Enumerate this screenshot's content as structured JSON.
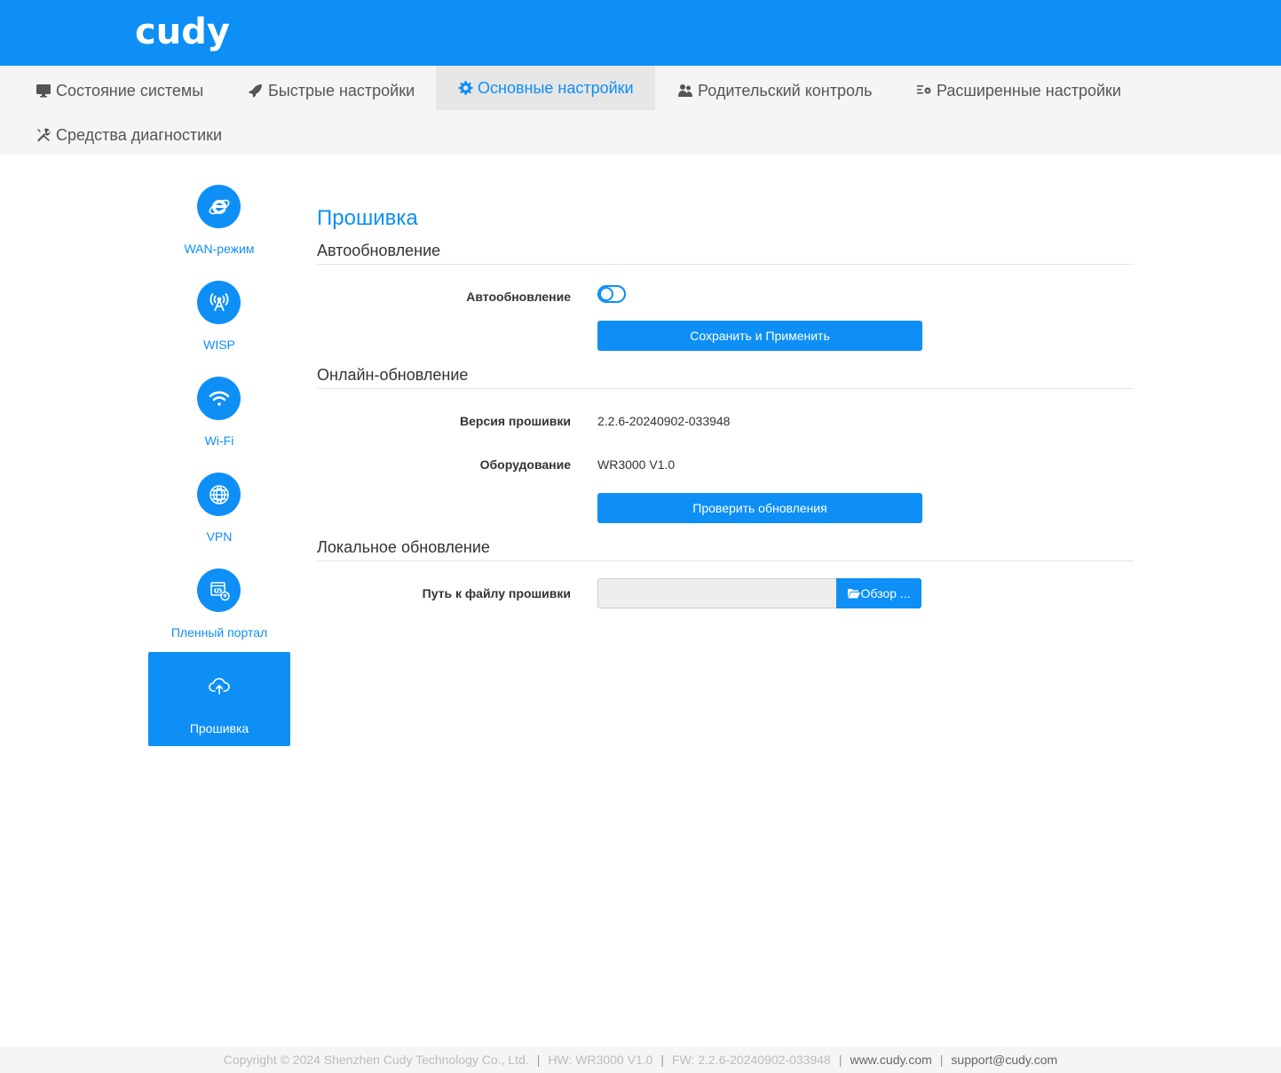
{
  "header": {
    "logo": "cudy"
  },
  "nav": {
    "items": [
      {
        "label": "Состояние системы",
        "icon": "monitor-icon"
      },
      {
        "label": "Быстрые настройки",
        "icon": "rocket-icon"
      },
      {
        "label": "Основные настройки",
        "icon": "gear-icon",
        "active": true
      },
      {
        "label": "Родительский контроль",
        "icon": "users-icon"
      },
      {
        "label": "Расширенные настройки",
        "icon": "advanced-settings-icon"
      },
      {
        "label": "Средства диагностики",
        "icon": "tools-icon"
      }
    ]
  },
  "sidebar": {
    "items": [
      {
        "label": "WAN-режим",
        "icon": "internet-explorer-icon"
      },
      {
        "label": "WISP",
        "icon": "antenna-icon"
      },
      {
        "label": "Wi-Fi",
        "icon": "wifi-icon"
      },
      {
        "label": "VPN",
        "icon": "globe-icon"
      },
      {
        "label": "Пленный портал",
        "icon": "portal-icon"
      },
      {
        "label": "Прошивка",
        "icon": "cloud-upload-icon",
        "active": true
      }
    ]
  },
  "main": {
    "title": "Прошивка",
    "auto": {
      "section": "Автообновление",
      "label": "Автообновление",
      "toggle_on": false,
      "save_button": "Сохранить и Применить"
    },
    "online": {
      "section": "Онлайн-обновление",
      "fw_label": "Версия прошивки",
      "fw_value": "2.2.6-20240902-033948",
      "hw_label": "Оборудование",
      "hw_value": "WR3000 V1.0",
      "check_button": "Проверить обновления"
    },
    "local": {
      "section": "Локальное обновление",
      "path_label": "Путь к файлу прошивки",
      "path_value": "",
      "browse_button": "Обзор ..."
    }
  },
  "footer": {
    "copyright": "Copyright © 2024 Shenzhen Cudy Technology Co., Ltd.",
    "hw": "HW: WR3000 V1.0",
    "fw": "FW: 2.2.6-20240902-033948",
    "website": "www.cudy.com",
    "support": "support@cudy.com",
    "separator": "|"
  },
  "colors": {
    "brand": "#0d8ff6",
    "nav_bg": "#f5f5f5",
    "nav_active_bg": "#e6e6e6"
  }
}
